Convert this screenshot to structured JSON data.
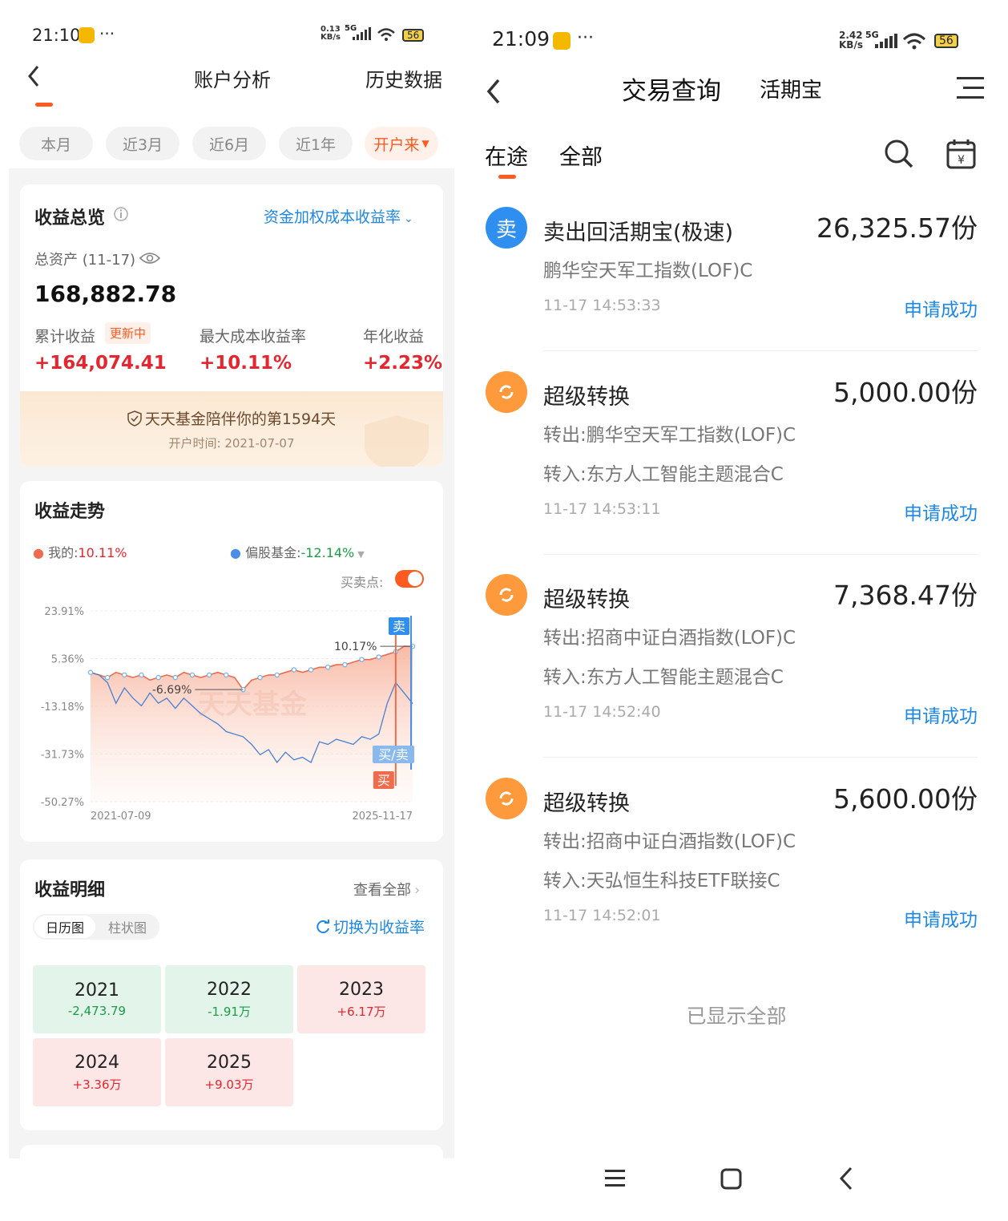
{
  "left": {
    "status_bar": {
      "time": "21:10",
      "dots": "···",
      "net_speed_top": "0.13",
      "net_speed_bottom": "KB/s",
      "net_type": "5G",
      "battery": "56"
    },
    "header": {
      "title": "账户分析",
      "right_link": "历史数据"
    },
    "period_chips": [
      "本月",
      "近3月",
      "近6月",
      "近1年",
      "开户来"
    ],
    "overview": {
      "title": "收益总览",
      "dropdown": "资金加权成本收益率",
      "asset_label": "总资产 (11-17)",
      "asset_value": "168,882.78",
      "cum_label": "累计收益",
      "updating_badge": "更新中",
      "cum_value": "+164,074.41",
      "max_label": "最大成本收益率",
      "max_value": "+10.11%",
      "annual_label": "年化收益",
      "annual_value": "+2.23%",
      "banner_text": "天天基金陪伴你的第1594天",
      "banner_sub": "开户时间: 2021-07-07"
    },
    "trend": {
      "title": "收益走势",
      "mine_label": "我的:",
      "mine_value": "10.11%",
      "bench_label": "偏股基金:",
      "bench_value": "-12.14%",
      "toggle_label": "买卖点:",
      "watermark": "天天基金",
      "ann_peak": "10.17%",
      "ann_low": "-6.69%",
      "tag_sell": "卖",
      "tag_buysell": "买/卖",
      "tag_buy": "买"
    },
    "chart_data": {
      "type": "area",
      "y_ticks": [
        "23.91%",
        "5.36%",
        "-13.18%",
        "-31.73%",
        "-50.27%"
      ],
      "x_ticks": [
        "2021-07-09",
        "2025-11-17"
      ],
      "ylim": [
        -50.27,
        23.91
      ],
      "series": [
        {
          "name": "我的",
          "color": "#ee6b4d",
          "values": [
            0,
            -1,
            -2,
            0,
            -1,
            -2,
            -1,
            -3,
            -2,
            -1,
            -2,
            0,
            -1,
            -2,
            -1,
            0,
            -1,
            -2,
            -6.69,
            -3,
            -2,
            -1,
            -1,
            0,
            1,
            0,
            1,
            2,
            2,
            3,
            3,
            4,
            5,
            5,
            6,
            7,
            8,
            10.17,
            10.11
          ]
        },
        {
          "name": "偏股基金",
          "color": "#4a7fd0",
          "values": [
            0,
            -1,
            -4,
            -12,
            -6,
            -10,
            -13,
            -8,
            -12,
            -10,
            -14,
            -10,
            -13,
            -16,
            -18,
            -20,
            -23,
            -24,
            -25,
            -28,
            -32,
            -30,
            -35,
            -31,
            -34,
            -33,
            -35,
            -27,
            -28,
            -26,
            -27,
            -28,
            -25,
            -26,
            -24,
            -12,
            -4,
            -8,
            -12.14
          ]
        }
      ]
    },
    "detail": {
      "title": "收益明细",
      "view_all": "查看全部",
      "tab_calendar": "日历图",
      "tab_bar": "柱状图",
      "switch_label": "切换为收益率",
      "years": [
        {
          "year": "2021",
          "value": "-2,473.79",
          "sign": "neg"
        },
        {
          "year": "2022",
          "value": "-1.91万",
          "sign": "neg"
        },
        {
          "year": "2023",
          "value": "+6.17万",
          "sign": "pos"
        },
        {
          "year": "2024",
          "value": "+3.36万",
          "sign": "pos"
        },
        {
          "year": "2025",
          "value": "+9.03万",
          "sign": "pos"
        }
      ]
    },
    "colors": {
      "accent": "#ff5a1f",
      "up": "#e3262f",
      "down": "#1a9c48",
      "link": "#1e88e5"
    }
  },
  "right": {
    "status_bar": {
      "time": "21:09",
      "dots": "···",
      "net_speed_top": "2.42",
      "net_speed_bottom": "KB/s",
      "net_type": "5G",
      "battery": "56"
    },
    "header": {
      "title": "交易查询",
      "subtitle": "活期宝"
    },
    "tabs": [
      "在途",
      "全部"
    ],
    "transactions": [
      {
        "icon_char": "卖",
        "icon_type": "sell",
        "title": "卖出回活期宝(极速)",
        "amount": "26,325.57份",
        "lines": [
          "鹏华空天军工指数(LOF)C"
        ],
        "time": "11-17 14:53:33",
        "status": "申请成功"
      },
      {
        "icon_char": "",
        "icon_type": "convert",
        "title": "超级转换",
        "amount": "5,000.00份",
        "lines": [
          "转出:鹏华空天军工指数(LOF)C",
          "转入:东方人工智能主题混合C"
        ],
        "time": "11-17 14:53:11",
        "status": "申请成功"
      },
      {
        "icon_char": "",
        "icon_type": "convert",
        "title": "超级转换",
        "amount": "7,368.47份",
        "lines": [
          "转出:招商中证白酒指数(LOF)C",
          "转入:东方人工智能主题混合C"
        ],
        "time": "11-17 14:52:40",
        "status": "申请成功"
      },
      {
        "icon_char": "",
        "icon_type": "convert",
        "title": "超级转换",
        "amount": "5,600.00份",
        "lines": [
          "转出:招商中证白酒指数(LOF)C",
          "转入:天弘恒生科技ETF联接C"
        ],
        "time": "11-17 14:52:01",
        "status": "申请成功"
      }
    ],
    "footer_text": "已显示全部",
    "colors": {
      "sell_icon": "#2f8ff0",
      "convert_icon": "#ff9a3c",
      "status": "#1e88e5"
    }
  }
}
